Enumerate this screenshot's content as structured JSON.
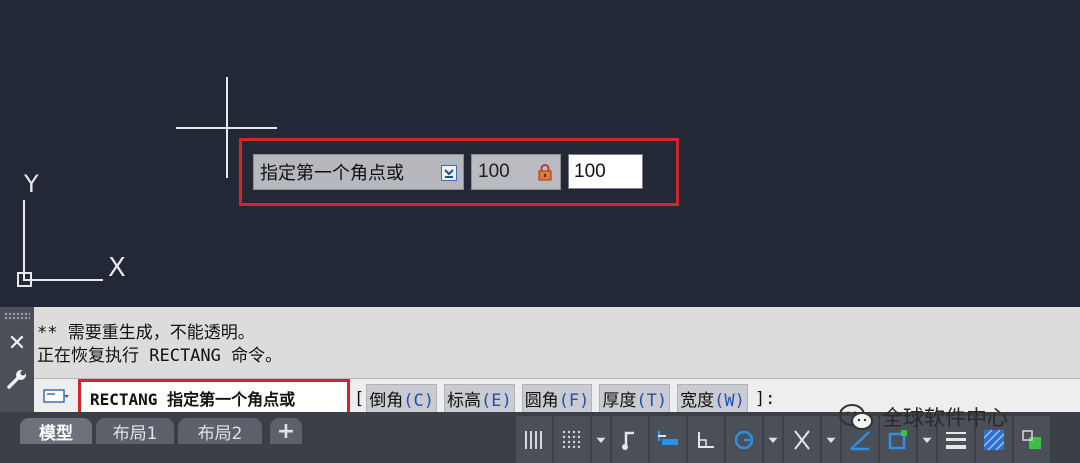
{
  "ucs": {
    "y_label": "Y",
    "x_label": "X"
  },
  "dynamic_input": {
    "prompt": "指定第一个角点或",
    "locked_value": "100",
    "input_value": "100"
  },
  "command_window": {
    "history": [
      "** 需要重生成，不能透明。",
      "正在恢复执行 RECTANG 命令。"
    ],
    "current_prompt": "RECTANG 指定第一个角点或",
    "open_bracket": "[",
    "options": [
      {
        "label": "倒角",
        "key": "(C)"
      },
      {
        "label": "标高",
        "key": "(E)"
      },
      {
        "label": "圆角",
        "key": "(F)"
      },
      {
        "label": "厚度",
        "key": "(T)"
      },
      {
        "label": "宽度",
        "key": "(W)"
      }
    ],
    "close_bracket": "]:"
  },
  "tabs": [
    {
      "label": "模型",
      "active": true
    },
    {
      "label": "布局1",
      "active": false
    },
    {
      "label": "布局2",
      "active": false
    },
    {
      "label": "+",
      "active": false
    }
  ],
  "status_tools": [
    "grid-icon",
    "snap-icon",
    "dropdown-arrow-icon",
    "infer-constraints-icon",
    "dynamic-input-icon",
    "ortho-icon",
    "polar-tracking-icon",
    "dropdown-arrow-icon",
    "isometric-icon",
    "dropdown-arrow-icon",
    "object-snap-tracking-icon",
    "object-snap-icon",
    "dropdown-arrow-icon",
    "lineweight-icon",
    "transparency-icon",
    "selection-cycling-icon"
  ],
  "watermark": "全球软件中心",
  "colors": {
    "drawing_bg": "#222836",
    "highlight_red": "#d3262a",
    "command_bg": "#dcdcdc",
    "status_bg": "#3b3f47",
    "accent_blue": "#2f8fe0"
  }
}
